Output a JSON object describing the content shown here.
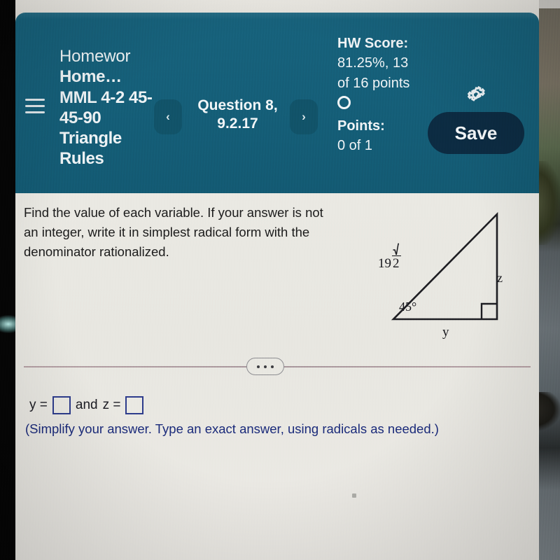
{
  "header": {
    "menu_icon": "hamburger-menu-icon",
    "title_line1": "Homewor",
    "title_line2": "Home… MML 4-2 45-45-90 Triangle Rules",
    "prev_icon": "‹",
    "next_icon": "›",
    "question_label": "Question 8, 9.2.17",
    "hw_score_label": "HW Score:",
    "hw_score_value": "81.25%, 13 of 16 points",
    "points_label": "Points:",
    "points_value": "0 of 1",
    "points_circle_icon": "empty-circle-icon",
    "gear_icon": "gear-icon",
    "save_label": "Save",
    "teal_color": "#15607a",
    "save_color": "#0c2b42"
  },
  "content": {
    "question_text": "Find the value of each variable. If your answer is not an integer, write it in simplest radical form with the denominator rationalized.",
    "figure": {
      "type": "right-triangle-45-45-90",
      "hypotenuse_label": "19√2",
      "hypotenuse_coefficient": "19",
      "hypotenuse_radicand": "2",
      "vertical_leg_label": "z",
      "horizontal_leg_label": "y",
      "angle_label": "45°",
      "right_angle_marker": "right-angle-square"
    },
    "divider_dots_icon": "ellipsis-icon",
    "answer": {
      "var1_label": "y =",
      "connector": "and",
      "var2_label": "z =",
      "var1_value": "",
      "var2_value": "",
      "var1_placeholder": "",
      "var2_placeholder": ""
    },
    "simplify_note": "(Simplify your answer. Type an exact answer, using radicals as needed.)",
    "note_color": "#1a2a7a"
  }
}
